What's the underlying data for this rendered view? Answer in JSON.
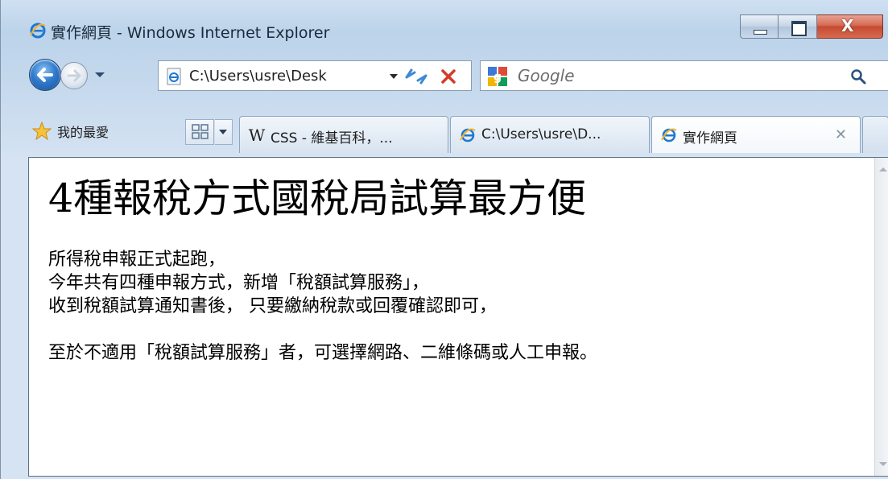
{
  "window": {
    "title": "實作網頁 - Windows Internet Explorer",
    "accent_color": "#c44a30"
  },
  "navigation": {
    "address": "C:\\Users\\usre\\Desk",
    "search_placeholder": "Google"
  },
  "favorites": {
    "label": "我的最愛"
  },
  "tabs": [
    {
      "label": "CSS - 維基百科，...",
      "icon": "wikipedia-icon",
      "active": false
    },
    {
      "label": "C:\\Users\\usre\\D...",
      "icon": "ie-page-icon",
      "active": false
    },
    {
      "label": "實作網頁",
      "icon": "ie-page-icon",
      "active": true
    }
  ],
  "page": {
    "heading": "4種報稅方式國稅局試算最方便",
    "lines": [
      "所得稅申報正式起跑，",
      "今年共有四種申報方式，新增「稅額試算服務」，",
      "收到稅額試算通知書後， 只要繳納稅款或回覆確認即可，"
    ],
    "closing_line": "至於不適用「稅額試算服務」者，可選擇網路、二維條碼或人工申報。"
  }
}
